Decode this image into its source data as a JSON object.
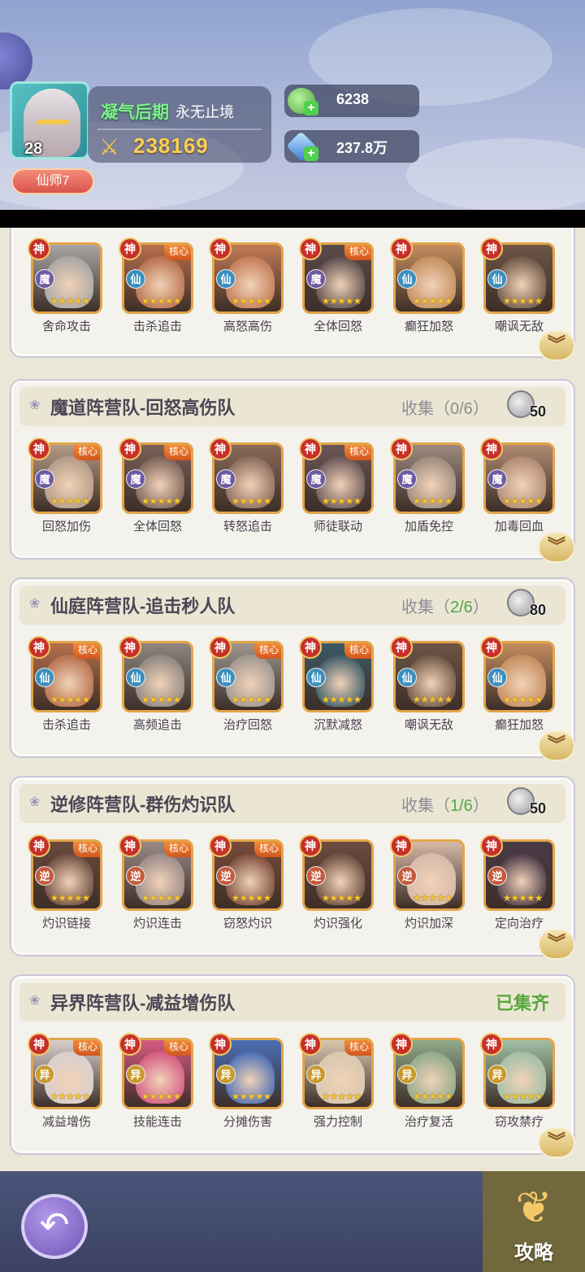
{
  "player": {
    "level": "28",
    "title_badge": "仙师7",
    "realm": "凝气后期",
    "server": "永无止境",
    "power": "238169"
  },
  "resources": [
    {
      "icon": "jade-coin-icon",
      "value": "6238"
    },
    {
      "icon": "spirit-crystal-icon",
      "value": "237.8万"
    }
  ],
  "teams": [
    {
      "title": "",
      "collect_label": "",
      "collected": "",
      "reward": "",
      "complete": false,
      "heroes": [
        {
          "skill": "舍命攻击",
          "shen": "神",
          "core": "",
          "faction": "魔",
          "faction_color": "#6e5aa3",
          "tone": "#a8a6a4"
        },
        {
          "skill": "击杀追击",
          "shen": "神",
          "core": "核心",
          "faction": "仙",
          "faction_color": "#3c8fbd",
          "tone": "#b76f4c"
        },
        {
          "skill": "高怒高伤",
          "shen": "神",
          "core": "",
          "faction": "仙",
          "faction_color": "#3c8fbd",
          "tone": "#c27a55"
        },
        {
          "skill": "全体回怒",
          "shen": "神",
          "core": "核心",
          "faction": "魔",
          "faction_color": "#6e5aa3",
          "tone": "#5a4b4b"
        },
        {
          "skill": "癫狂加怒",
          "shen": "神",
          "core": "",
          "faction": "仙",
          "faction_color": "#3c8fbd",
          "tone": "#c48d5e"
        },
        {
          "skill": "嘲讽无敌",
          "shen": "神",
          "core": "",
          "faction": "仙",
          "faction_color": "#3c8fbd",
          "tone": "#6e5545"
        }
      ]
    },
    {
      "title": "魔道阵营队-回怒高伤队",
      "collect_label": "收集（",
      "collected": "0/6",
      "collect_end": "）",
      "reward": "50",
      "complete": false,
      "heroes": [
        {
          "skill": "回怒加伤",
          "shen": "神",
          "core": "核心",
          "faction": "魔",
          "faction_color": "#6e5aa3",
          "tone": "#b39a86"
        },
        {
          "skill": "全体回怒",
          "shen": "神",
          "core": "核心",
          "faction": "魔",
          "faction_color": "#6e5aa3",
          "tone": "#7b6158"
        },
        {
          "skill": "转怒追击",
          "shen": "神",
          "core": "",
          "faction": "魔",
          "faction_color": "#6e5aa3",
          "tone": "#8a6a5a"
        },
        {
          "skill": "师徒联动",
          "shen": "神",
          "core": "核心",
          "faction": "魔",
          "faction_color": "#6e5aa3",
          "tone": "#6a5656"
        },
        {
          "skill": "加盾免控",
          "shen": "神",
          "core": "",
          "faction": "魔",
          "faction_color": "#6e5aa3",
          "tone": "#9c8a7e"
        },
        {
          "skill": "加毒回血",
          "shen": "神",
          "core": "",
          "faction": "魔",
          "faction_color": "#6e5aa3",
          "tone": "#b08a72"
        }
      ]
    },
    {
      "title": "仙庭阵营队-追击秒人队",
      "collect_label": "收集（",
      "collected": "2/6",
      "collect_end": "）",
      "reward": "80",
      "complete": false,
      "heroes": [
        {
          "skill": "击杀追击",
          "shen": "神",
          "core": "核心",
          "faction": "仙",
          "faction_color": "#3c8fbd",
          "tone": "#b76f4c"
        },
        {
          "skill": "高频追击",
          "shen": "神",
          "core": "",
          "faction": "仙",
          "faction_color": "#3c8fbd",
          "tone": "#8e8680"
        },
        {
          "skill": "治疗回怒",
          "shen": "神",
          "core": "核心",
          "faction": "仙",
          "faction_color": "#3c8fbd",
          "tone": "#9e9690"
        },
        {
          "skill": "沉默减怒",
          "shen": "神",
          "core": "核心",
          "faction": "仙",
          "faction_color": "#3c8fbd",
          "tone": "#3c5a66"
        },
        {
          "skill": "嘲讽无敌",
          "shen": "神",
          "core": "",
          "faction": "仙",
          "faction_color": "#3c8fbd",
          "tone": "#6e5545"
        },
        {
          "skill": "癫狂加怒",
          "shen": "神",
          "core": "",
          "faction": "仙",
          "faction_color": "#3c8fbd",
          "tone": "#c48d5e"
        }
      ]
    },
    {
      "title": "逆修阵营队-群伤灼识队",
      "collect_label": "收集（",
      "collected": "1/6",
      "collect_end": "）",
      "reward": "50",
      "complete": false,
      "heroes": [
        {
          "skill": "灼识链接",
          "shen": "神",
          "core": "核心",
          "faction": "逆",
          "faction_color": "#c45a3c",
          "tone": "#6a4a3c"
        },
        {
          "skill": "灼识连击",
          "shen": "神",
          "core": "核心",
          "faction": "逆",
          "faction_color": "#c45a3c",
          "tone": "#9a8a88"
        },
        {
          "skill": "窃怒灼识",
          "shen": "神",
          "core": "核心",
          "faction": "逆",
          "faction_color": "#c45a3c",
          "tone": "#7a4b3a"
        },
        {
          "skill": "灼识强化",
          "shen": "神",
          "core": "",
          "faction": "逆",
          "faction_color": "#c45a3c",
          "tone": "#6c4c3e"
        },
        {
          "skill": "灼识加深",
          "shen": "神",
          "core": "",
          "faction": "逆",
          "faction_color": "#c45a3c",
          "tone": "#d6b9a8"
        },
        {
          "skill": "定向治疗",
          "shen": "神",
          "core": "",
          "faction": "逆",
          "faction_color": "#c45a3c",
          "tone": "#4a3a46"
        }
      ]
    },
    {
      "title": "异界阵营队-减益增伤队",
      "collect_label": "",
      "collected": "",
      "reward": "",
      "complete": true,
      "complete_label": "已集齐",
      "heroes": [
        {
          "skill": "减益增伤",
          "shen": "神",
          "core": "核心",
          "faction": "异",
          "faction_color": "#c99a2e",
          "tone": "#d8cfcf"
        },
        {
          "skill": "技能连击",
          "shen": "神",
          "core": "核心",
          "faction": "异",
          "faction_color": "#c99a2e",
          "tone": "#d45a82"
        },
        {
          "skill": "分摊伤害",
          "shen": "神",
          "core": "",
          "faction": "异",
          "faction_color": "#c99a2e",
          "tone": "#4a6fb5"
        },
        {
          "skill": "强力控制",
          "shen": "神",
          "core": "核心",
          "faction": "异",
          "faction_color": "#c99a2e",
          "tone": "#d8c8b0"
        },
        {
          "skill": "治疗复活",
          "shen": "神",
          "core": "",
          "faction": "异",
          "faction_color": "#c99a2e",
          "tone": "#8faa8a"
        },
        {
          "skill": "窃攻禁疗",
          "shen": "神",
          "core": "",
          "faction": "异",
          "faction_color": "#c99a2e",
          "tone": "#a0c0a6"
        }
      ]
    }
  ],
  "bottom": {
    "guide_label": "攻略"
  }
}
